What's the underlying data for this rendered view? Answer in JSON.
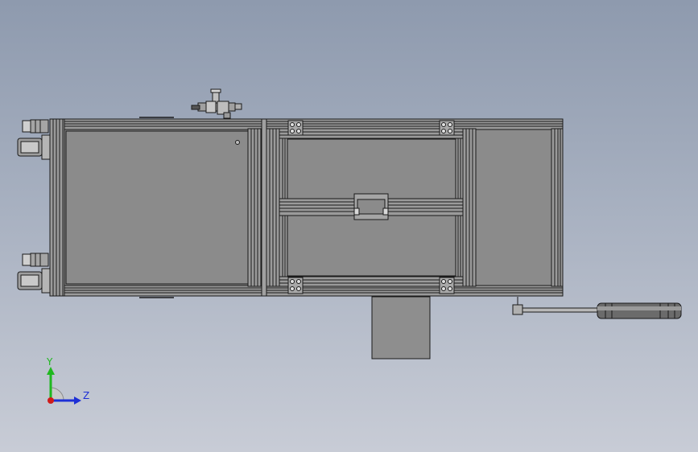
{
  "triad": {
    "y_label": "Y",
    "z_label": "Z",
    "colors": {
      "y_axis": "#1fb81f",
      "z_axis": "#1d2fd6",
      "x_axis": "#d01b1b"
    }
  },
  "colors": {
    "background_top": "#8e9aae",
    "background_bottom": "#c8ccd6",
    "panel_fill": "#8c8c8c",
    "line": "#1a1a1a"
  }
}
